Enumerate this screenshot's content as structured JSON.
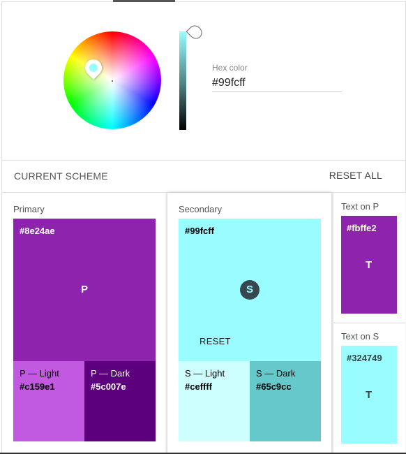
{
  "picker": {
    "hex_label": "Hex color",
    "hex_value": "#99fcff",
    "selected_color": "#99fcff"
  },
  "scheme": {
    "title": "CURRENT SCHEME",
    "reset_all_label": "RESET ALL"
  },
  "primary": {
    "title": "Primary",
    "main": {
      "code": "#8e24ae",
      "letter": "P",
      "color": "#8e24ae",
      "text_color": "#ffffff"
    },
    "light": {
      "label": "P — Light",
      "code": "#c159e1",
      "color": "#c159e1",
      "text_color": "#000000"
    },
    "dark": {
      "label": "P — Dark",
      "code": "#5c007e",
      "color": "#5c007e",
      "text_color": "#ffffff"
    }
  },
  "secondary": {
    "title": "Secondary",
    "main": {
      "code": "#99fcff",
      "badge": "S",
      "reset_label": "RESET",
      "color": "#99fcff",
      "text_color": "#000000"
    },
    "light": {
      "label": "S — Light",
      "code": "#ceffff",
      "color": "#ceffff",
      "text_color": "#000000"
    },
    "dark": {
      "label": "S — Dark",
      "code": "#65c9cc",
      "color": "#65c9cc",
      "text_color": "#000000"
    }
  },
  "text_on_p": {
    "title": "Text on P",
    "code": "#fbffe2",
    "letter": "T",
    "background": "#8e24ae",
    "text_color": "#fbffe2"
  },
  "text_on_s": {
    "title": "Text on S",
    "code": "#324749",
    "letter": "T",
    "background": "#99fcff",
    "text_color": "#324749"
  }
}
